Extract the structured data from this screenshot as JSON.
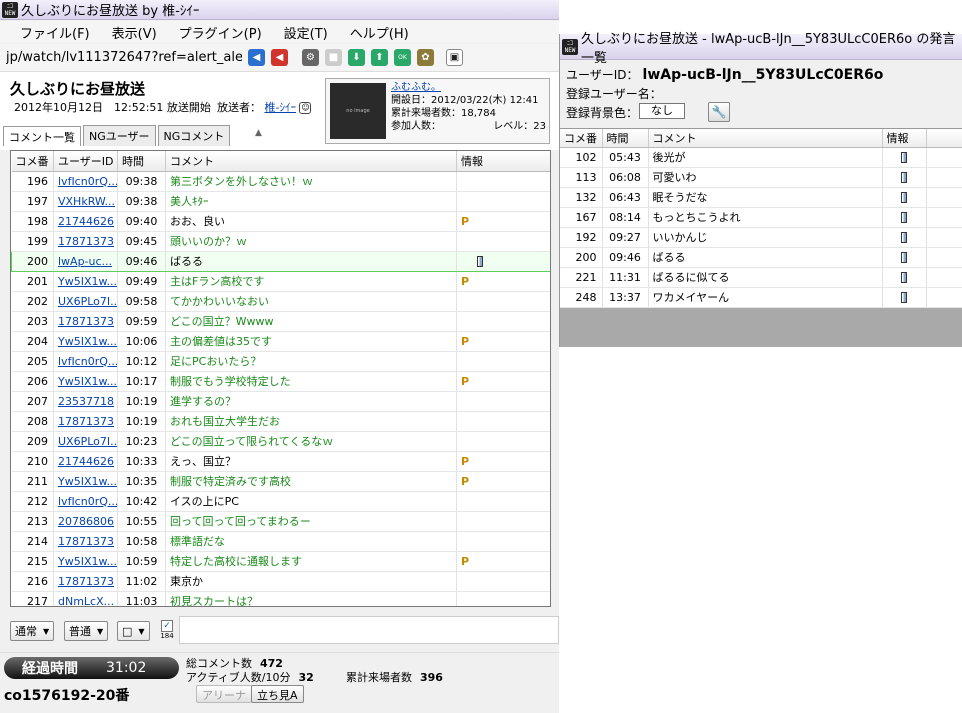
{
  "main": {
    "title": "久しぶりにお昼放送 by 椎-ｼｲｰ",
    "menu": [
      "ファイル(F)",
      "表示(V)",
      "プラグイン(P)",
      "設定(T)",
      "ヘルプ(H)"
    ],
    "url": "jp/watch/lv111372647?ref=alert_alert",
    "live_title": "久しぶりにお昼放送",
    "start_time": "2012年10月12日　12:52:51 放送開始",
    "caster_label": "放送者：",
    "caster_name": "椎-ｼｲｰ",
    "thumb_text": "no image",
    "community_link": "ふむふむ。",
    "opened": "開設日：2012/03/22(木) 12:41",
    "total_visitors": "累計来場者数：18,784",
    "participants": "参加人数：",
    "level": "レベル：23",
    "tabs": [
      "コメント一覧",
      "NGユーザー",
      "NGコメント"
    ],
    "columns": [
      "コメ番",
      "ユーザーID",
      "時間",
      "コメント",
      "情報"
    ],
    "comments": [
      {
        "num": "196",
        "uid": "lvfIcn0rQ...",
        "time": "09:38",
        "text": "第三ボタンを外しなさい！ｗ",
        "info": ""
      },
      {
        "num": "197",
        "uid": "VXHkRW...",
        "time": "09:38",
        "text": "美人ｷﾀｰ",
        "info": ""
      },
      {
        "num": "198",
        "uid": "21744626",
        "time": "09:40",
        "text": "おお、良い",
        "info": "P"
      },
      {
        "num": "199",
        "uid": "17871373",
        "time": "09:45",
        "text": "頭いいのか？ｗ",
        "info": ""
      },
      {
        "num": "200",
        "uid": "lwAp-uc...",
        "time": "09:46",
        "text": "ばるる",
        "info": "M"
      },
      {
        "num": "201",
        "uid": "Yw5IX1w...",
        "time": "09:49",
        "text": "主はFラン高校です",
        "info": "P"
      },
      {
        "num": "202",
        "uid": "UX6PLo7I...",
        "time": "09:58",
        "text": "てかかわいいなおい",
        "info": ""
      },
      {
        "num": "203",
        "uid": "17871373",
        "time": "09:59",
        "text": "どこの国立？Wwww",
        "info": ""
      },
      {
        "num": "204",
        "uid": "Yw5IX1w...",
        "time": "10:06",
        "text": "主の偏差値は35です",
        "info": "P"
      },
      {
        "num": "205",
        "uid": "lvfIcn0rQ...",
        "time": "10:12",
        "text": "足にPCおいたら？",
        "info": ""
      },
      {
        "num": "206",
        "uid": "Yw5IX1w...",
        "time": "10:17",
        "text": "制服でもう学校特定した",
        "info": "P"
      },
      {
        "num": "207",
        "uid": "23537718",
        "time": "10:19",
        "text": "進学するの？",
        "info": ""
      },
      {
        "num": "208",
        "uid": "17871373",
        "time": "10:19",
        "text": "おれも国立大学生だお",
        "info": ""
      },
      {
        "num": "209",
        "uid": "UX6PLo7I...",
        "time": "10:23",
        "text": "どこの国立って限られてくるなｗ",
        "info": ""
      },
      {
        "num": "210",
        "uid": "21744626",
        "time": "10:33",
        "text": "えっ、国立？",
        "info": "P"
      },
      {
        "num": "211",
        "uid": "Yw5IX1w...",
        "time": "10:35",
        "text": "制服で特定済みです高校",
        "info": "P"
      },
      {
        "num": "212",
        "uid": "lvfIcn0rQ...",
        "time": "10:42",
        "text": "イスの上にPC",
        "info": ""
      },
      {
        "num": "213",
        "uid": "20786806",
        "time": "10:55",
        "text": "回って回って回ってまわるー",
        "info": ""
      },
      {
        "num": "214",
        "uid": "17871373",
        "time": "10:58",
        "text": "標準語だな",
        "info": ""
      },
      {
        "num": "215",
        "uid": "Yw5IX1w...",
        "time": "10:59",
        "text": "特定した高校に通報します",
        "info": "P"
      },
      {
        "num": "216",
        "uid": "17871373",
        "time": "11:02",
        "text": "東京か",
        "info": ""
      },
      {
        "num": "217",
        "uid": "dNmLcX...",
        "time": "11:03",
        "text": "初見スカートは？",
        "info": ""
      }
    ],
    "dd_mode": "通常",
    "dd_size": "普通",
    "dd_color": "□",
    "anon_label": "184",
    "elapsed_label": "経過時間",
    "elapsed_value": "31:02",
    "total_comments_label": "総コメント数",
    "total_comments": "472",
    "active_label": "アクティブ人数/10分",
    "active": "32",
    "visitors_label": "累計来場者数",
    "visitors": "396",
    "community_id": "co1576192-20番",
    "arena_button": "アリーナ",
    "standing_button": "立ち見A"
  },
  "user_window": {
    "title": "久しぶりにお昼放送 - lwAp-ucB-lJn__5Y83ULcC0ER6o の発言一覧",
    "user_id_label": "ユーザーID：",
    "user_id": "lwAp-ucB-lJn__5Y83ULcC0ER6o",
    "reg_name_label": "登録ユーザー名：",
    "bg_color_label": "登録背景色：",
    "bg_color_value": "なし",
    "columns": [
      "コメ番",
      "時間",
      "コメント",
      "情報"
    ],
    "comments": [
      {
        "num": "102",
        "time": "05:43",
        "text": "後光が"
      },
      {
        "num": "113",
        "time": "06:08",
        "text": "可愛いわ"
      },
      {
        "num": "132",
        "time": "06:43",
        "text": "眠そうだな"
      },
      {
        "num": "167",
        "time": "08:14",
        "text": "もっとちこうよれ"
      },
      {
        "num": "192",
        "time": "09:27",
        "text": "いいかんじ"
      },
      {
        "num": "200",
        "time": "09:46",
        "text": "ばるる"
      },
      {
        "num": "221",
        "time": "11:31",
        "text": "ばるるに似てる"
      },
      {
        "num": "248",
        "time": "13:37",
        "text": "ワカメイヤーん"
      }
    ]
  }
}
